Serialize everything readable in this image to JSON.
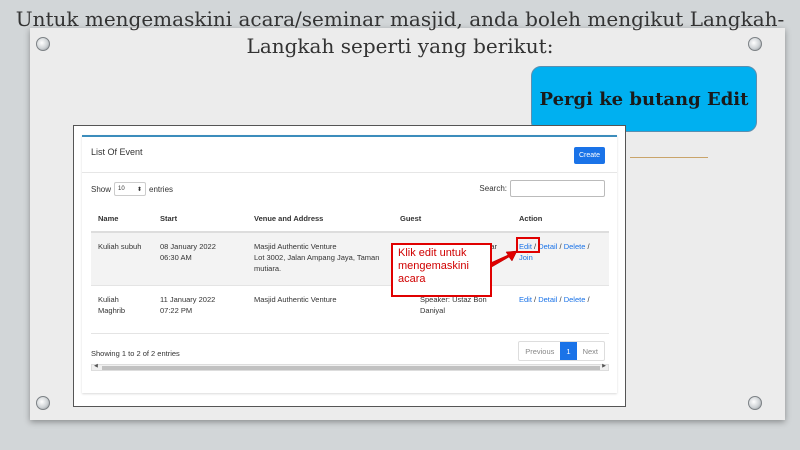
{
  "slide": {
    "heading": "Untuk mengemaskini acara/seminar masjid, anda boleh mengikut Langkah-Langkah seperti yang berikut:",
    "callout": "Pergi ke butang Edit",
    "annotation": "Klik edit untuk mengemaskini acara"
  },
  "panel": {
    "title": "List Of Event",
    "create_label": "Create",
    "show_label": "Show",
    "length_value": "10",
    "entries_label": "entries",
    "search_label": "Search:",
    "search_value": ""
  },
  "table": {
    "headers": [
      "Name",
      "Start",
      "Venue and Address",
      "Guest",
      "Action"
    ],
    "rows": [
      {
        "name": "Kuliah subuh",
        "start_date": "08 January 2022",
        "start_time": "06:30 AM",
        "venue": "Masjid Authentic Venture",
        "address": "Lot 3002, Jalan Ampang Jaya, Taman mutiara.",
        "guest": "ar"
      },
      {
        "name": "Kuliah Maghrib",
        "start_date": "11 January 2022",
        "start_time": "07:22 PM",
        "venue": "Masjid Authentic Venture",
        "address": "",
        "guest": "Speaker: Ustaz Bon Daniyal"
      }
    ],
    "actions": {
      "edit": "Edit",
      "detail": "Detail",
      "delete": "Delete",
      "join": "Join",
      "separator": "/"
    }
  },
  "footer": {
    "info": "Showing 1 to 2 of 2 entries",
    "previous": "Previous",
    "page": "1",
    "next": "Next"
  },
  "colors": {
    "callout_bg": "#00b0f0",
    "panel_accent": "#3c8dbc",
    "link": "#1a73e8",
    "annotation_red": "#e00000"
  }
}
